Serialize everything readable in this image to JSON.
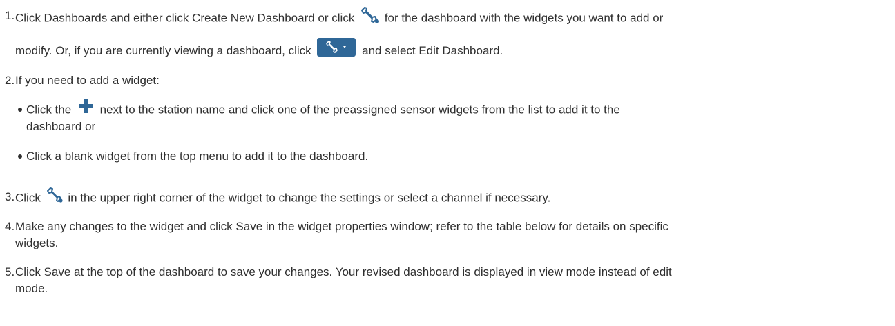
{
  "step1": {
    "number": "1.",
    "text_a": "Click Dashboards and either click Create New Dashboard or click",
    "text_b": "for the dashboard with the widgets you want to add or",
    "text_c": "modify. Or, if you are currently viewing a dashboard, click",
    "text_d": "and select Edit Dashboard."
  },
  "step2": {
    "number": "2.",
    "text": "If you need to add a widget:",
    "bullets": {
      "b1_a": "Click the",
      "b1_b": "next to the station name and click one of the preassigned sensor widgets from the list to add it to the",
      "b1_c": "dashboard or",
      "b2": "Click a blank widget from the top menu to add it to the dashboard."
    }
  },
  "step3": {
    "number": "3.",
    "text_a": "Click",
    "text_b": "in the upper right corner of the widget to change the settings or select a channel if necessary."
  },
  "step4": {
    "number": "4.",
    "text_a": "Make any changes to the widget and click Save in the widget properties window; refer to the table below for details on specific",
    "text_b": "widgets."
  },
  "step5": {
    "number": "5.",
    "text_a": "Click Save at the top of the dashboard to save your changes. Your revised dashboard is displayed in view mode instead of edit",
    "text_b": "mode."
  },
  "icons": {
    "wrench": "wrench-icon",
    "wrench_dropdown": "wrench-dropdown-button",
    "plus": "plus-icon"
  },
  "colors": {
    "text": "#2f2f2f",
    "accent": "#2f6797",
    "wrench_stroke": "#2f6797"
  }
}
